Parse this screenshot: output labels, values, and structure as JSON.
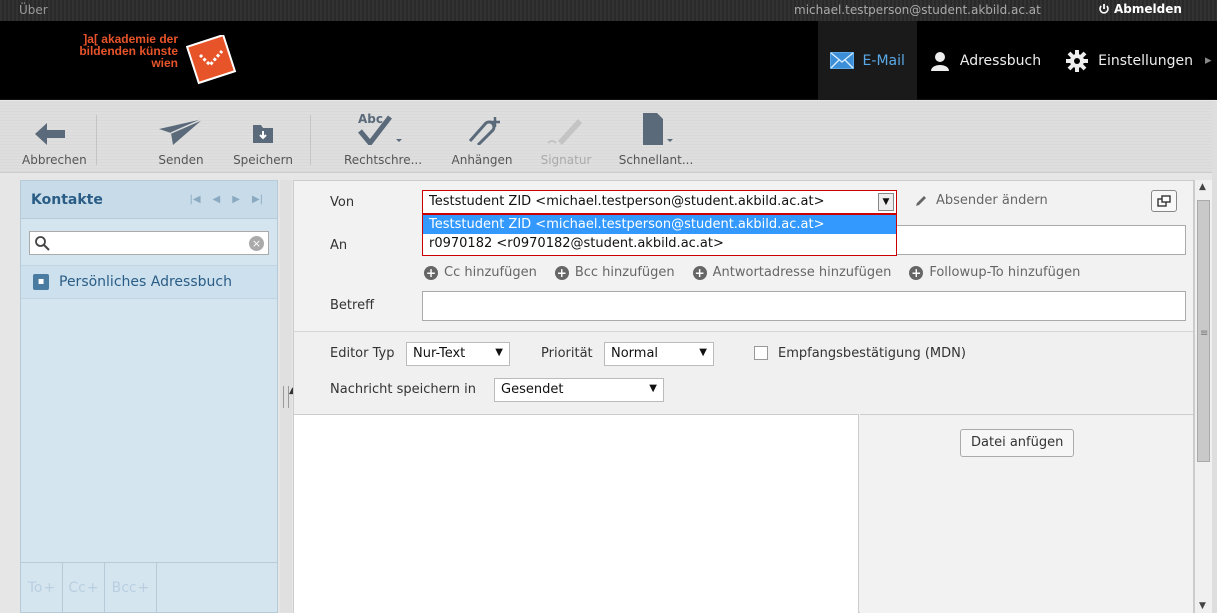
{
  "topbar": {
    "about": "Über",
    "user_email": "michael.testperson@student.akbild.ac.at",
    "logout_label": "Abmelden"
  },
  "header": {
    "logo_lines": [
      "]a[ akademie der",
      "bildenden künste",
      "wien"
    ],
    "nav": [
      {
        "label": "E-Mail",
        "icon": "mail-icon",
        "active": true
      },
      {
        "label": "Adressbuch",
        "icon": "person-icon",
        "active": false
      },
      {
        "label": "Einstellungen",
        "icon": "gear-icon",
        "active": false
      }
    ]
  },
  "toolbar": {
    "cancel_label": "Abbrechen",
    "send_label": "Senden",
    "save_label": "Speichern",
    "spellcheck_label": "Rechtschre...",
    "attach_label": "Anhängen",
    "signature_label": "Signatur",
    "quicktext_label": "Schnellant..."
  },
  "contacts": {
    "title": "Kontakte",
    "search_placeholder": "",
    "addressbook_label": "Persönliches Adressbuch",
    "recipient_buttons": [
      "To",
      "Cc",
      "Bcc"
    ]
  },
  "compose": {
    "from_label": "Von",
    "from_value": "Teststudent ZID <michael.testperson@student.akbild.ac.at>",
    "from_options": [
      "Teststudent ZID <michael.testperson@student.akbild.ac.at>",
      "r0970182 <r0970182@student.akbild.ac.at>"
    ],
    "change_sender_label": "Absender ändern",
    "to_label": "An",
    "add_links": [
      "Cc hinzufügen",
      "Bcc hinzufügen",
      "Antwortadresse hinzufügen",
      "Followup-To hinzufügen"
    ],
    "subject_label": "Betreff",
    "editor_type_label": "Editor Typ",
    "editor_type_value": "Nur-Text",
    "priority_label": "Priorität",
    "priority_value": "Normal",
    "receipt_label": "Empfangsbestätigung (MDN)",
    "save_in_label": "Nachricht speichern in",
    "save_in_value": "Gesendet",
    "attach_button": "Datei anfügen"
  },
  "colors": {
    "header_bg": "#000000",
    "accent_blue": "#5aa9e6",
    "logo_orange": "#e8542a",
    "selection_blue": "#3399ff",
    "error_red": "#cc0000",
    "panel_blue": "#d5e5f0"
  }
}
